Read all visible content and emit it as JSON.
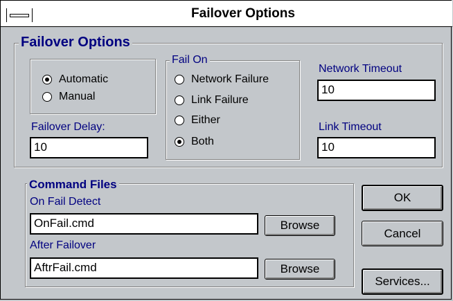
{
  "window": {
    "title": "Failover Options"
  },
  "failover_options": {
    "legend": "Failover Options",
    "mode_options": [
      {
        "label": "Automatic",
        "checked": true
      },
      {
        "label": "Manual",
        "checked": false
      }
    ],
    "failover_delay": {
      "label": "Failover Delay:",
      "value": "10"
    },
    "fail_on": {
      "legend": "Fail On",
      "options": [
        {
          "label": "Network Failure",
          "checked": false
        },
        {
          "label": "Link Failure",
          "checked": false
        },
        {
          "label": "Either",
          "checked": false
        },
        {
          "label": "Both",
          "checked": true
        }
      ]
    },
    "network_timeout": {
      "label": "Network Timeout",
      "value": "10"
    },
    "link_timeout": {
      "label": "Link Timeout",
      "value": "10"
    }
  },
  "command_files": {
    "legend": "Command Files",
    "on_fail_detect": {
      "label": "On Fail Detect",
      "value": "OnFail.cmd",
      "browse_label": "Browse"
    },
    "after_failover": {
      "label": "After Failover",
      "value": "AftrFail.cmd",
      "browse_label": "Browse"
    }
  },
  "buttons": {
    "ok": "OK",
    "cancel": "Cancel",
    "services": "Services..."
  }
}
